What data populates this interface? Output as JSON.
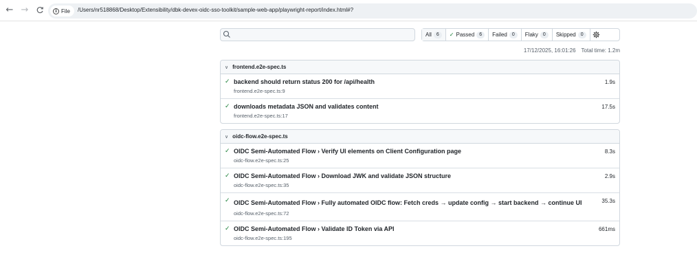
{
  "browser": {
    "back_icon": "arrow-left-icon",
    "forward_icon": "arrow-right-icon",
    "reload_icon": "reload-icon",
    "chip_label": "File",
    "url": "/Users/nr518868/Desktop/Extensibility/dbk-devex-oidc-sso-toolkit/sample-web-app/playwright-report/index.html#?"
  },
  "toolbar": {
    "search_value": "",
    "filters": [
      {
        "label": "All",
        "count": "6"
      },
      {
        "label": "Passed",
        "count": "6"
      },
      {
        "label": "Failed",
        "count": "0"
      },
      {
        "label": "Flaky",
        "count": "0"
      },
      {
        "label": "Skipped",
        "count": "0"
      }
    ],
    "settings_icon": "gear-icon"
  },
  "meta": {
    "timestamp": "17/12/2025, 16:01:26",
    "total_time": "Total time: 1.2m"
  },
  "files": [
    {
      "name": "frontend.e2e-spec.ts",
      "tests": [
        {
          "title": "backend should return status 200 for /api/health",
          "location": "frontend.e2e-spec.ts:9",
          "duration": "1.9s"
        },
        {
          "title": "downloads metadata JSON and validates content",
          "location": "frontend.e2e-spec.ts:17",
          "duration": "17.5s"
        }
      ]
    },
    {
      "name": "oidc-flow.e2e-spec.ts",
      "tests": [
        {
          "title": "OIDC Semi-Automated Flow › Verify UI elements on Client Configuration page",
          "location": "oidc-flow.e2e-spec.ts:25",
          "duration": "8.3s"
        },
        {
          "title": "OIDC Semi-Automated Flow › Download JWK and validate JSON structure",
          "location": "oidc-flow.e2e-spec.ts:35",
          "duration": "2.9s"
        },
        {
          "title": "OIDC Semi-Automated Flow › Fully automated OIDC flow: Fetch creds → update config → start backend → continue UI",
          "location": "oidc-flow.e2e-spec.ts:72",
          "duration": "35.3s"
        },
        {
          "title": "OIDC Semi-Automated Flow › Validate ID Token via API",
          "location": "oidc-flow.e2e-spec.ts:195",
          "duration": "661ms"
        }
      ]
    }
  ],
  "colors": {
    "passed": "#1a7f37",
    "border": "#d0d7de",
    "muted": "#57606a"
  }
}
